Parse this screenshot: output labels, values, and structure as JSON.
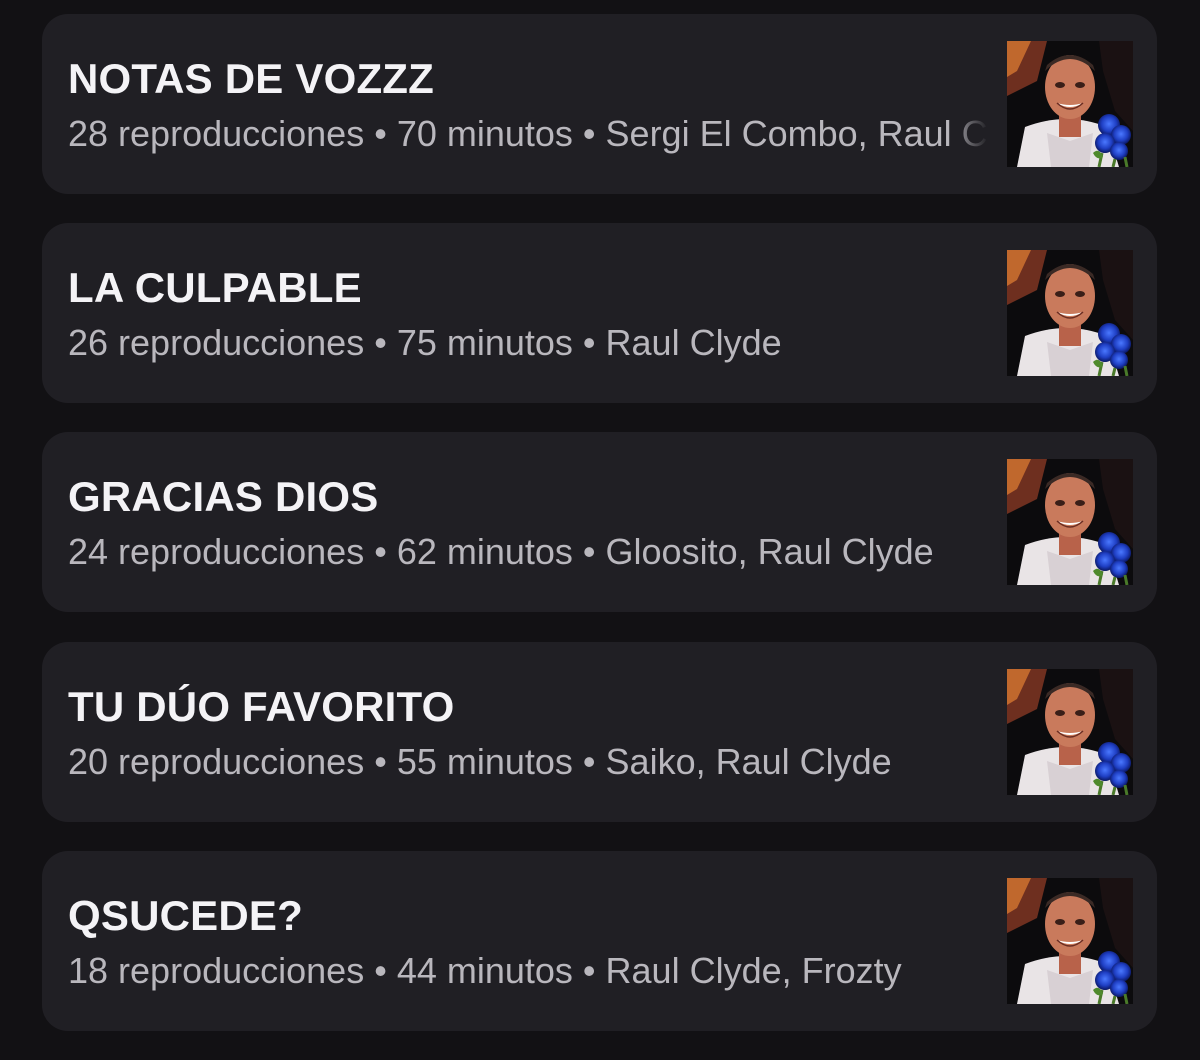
{
  "playlists": [
    {
      "title": "NOTAS DE VOZZZ",
      "plays": "28 reproducciones",
      "duration": "70 minutos",
      "artists": "Sergi El Combo, Raul Clyde",
      "thumbnail": "cover-image-man-blue-roses"
    },
    {
      "title": "LA CULPABLE",
      "plays": "26 reproducciones",
      "duration": "75 minutos",
      "artists": "Raul Clyde",
      "thumbnail": "cover-image-man-blue-roses"
    },
    {
      "title": "GRACIAS DIOS",
      "plays": "24 reproducciones",
      "duration": "62 minutos",
      "artists": "Gloosito, Raul Clyde",
      "thumbnail": "cover-image-man-blue-roses"
    },
    {
      "title": "TU DÚO FAVORITO",
      "plays": "20 reproducciones",
      "duration": "55 minutos",
      "artists": "Saiko, Raul Clyde",
      "thumbnail": "cover-image-man-blue-roses"
    },
    {
      "title": "QSUCEDE?",
      "plays": "18 reproducciones",
      "duration": "44 minutos",
      "artists": "Raul Clyde, Frozty",
      "thumbnail": "cover-image-man-blue-roses"
    }
  ],
  "separator": "•",
  "colors": {
    "background": "#121114",
    "card": "#201f24",
    "title": "#f4f3f6",
    "meta": "#b9b7bd"
  }
}
